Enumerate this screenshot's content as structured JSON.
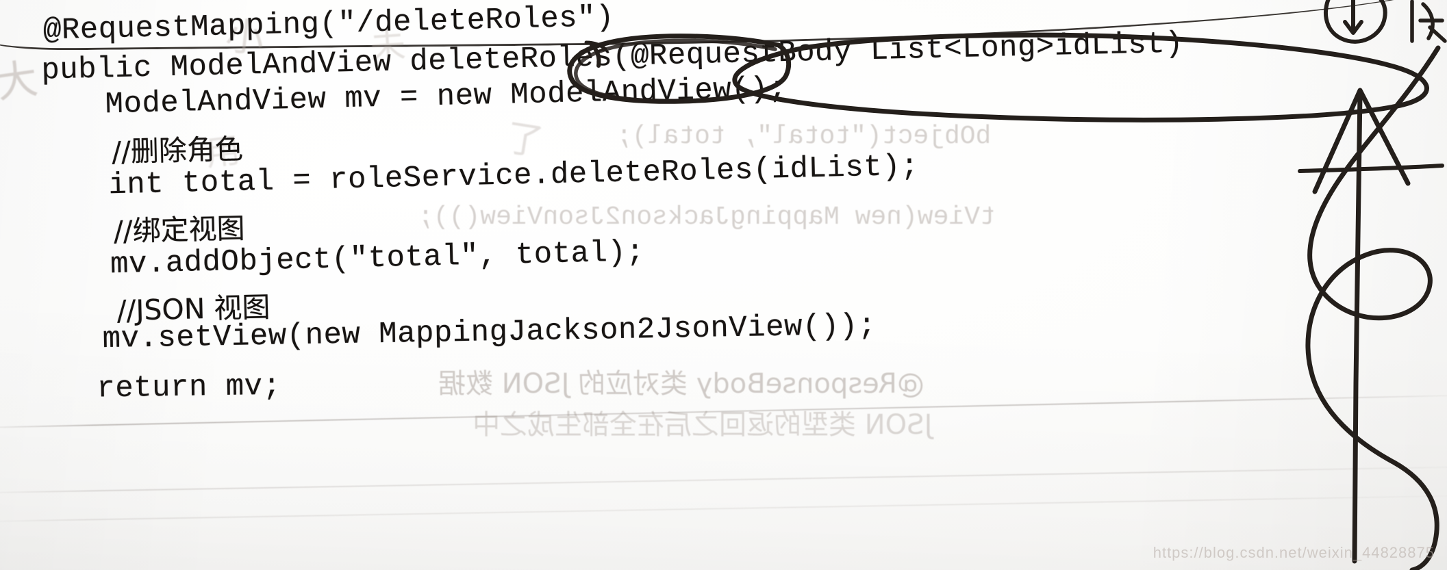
{
  "document": {
    "kind": "scanned-textbook-page",
    "language": "java",
    "watermark": "https://blog.csdn.net/weixin_44828875"
  },
  "code": {
    "lines": [
      {
        "id": "l0",
        "text": "@RequestMapping(\"/deleteRoles\")",
        "kind": "code"
      },
      {
        "id": "l1",
        "text": "public ModelAndView deleteRoles(@RequestBody List<Long>idList)",
        "kind": "code"
      },
      {
        "id": "l2",
        "text": "ModelAndView mv = new ModelAndView();",
        "kind": "code"
      },
      {
        "id": "l3",
        "text": "//删除角色",
        "kind": "comment"
      },
      {
        "id": "l4",
        "text": "int total = roleService.deleteRoles(idList);",
        "kind": "code"
      },
      {
        "id": "l5",
        "text": "//绑定视图",
        "kind": "comment"
      },
      {
        "id": "l6",
        "text": "mv.addObject(\"total\", total);",
        "kind": "code"
      },
      {
        "id": "l7",
        "text": "//JSON 视图",
        "kind": "comment"
      },
      {
        "id": "l8",
        "text": "mv.setView(new MappingJackson2JsonView());",
        "kind": "code"
      },
      {
        "id": "l9",
        "text": "return mv;",
        "kind": "code"
      }
    ]
  },
  "annotations": {
    "circle_inner_label": "@RequestBody",
    "circle_outer_label": "@RequestBody List<Long>idList",
    "marks": [
      {
        "name": "ellipse-around-requestbody",
        "type": "ellipse"
      },
      {
        "name": "ellipse-around-parameter-list",
        "type": "ellipse"
      },
      {
        "name": "up-arrow-pointing-to-parameter",
        "type": "arrow"
      },
      {
        "name": "vertical-squiggle-scribble",
        "type": "squiggle"
      },
      {
        "name": "top-right-handwriting-mark",
        "type": "scribble"
      }
    ]
  },
  "bleed_through": {
    "lines": [
      "bObject(\"total\", total);",
      "tView(new MappingJackson2JsonView());",
      "@ResponseBody 类对应的 JSON 数据",
      "JSON 类型的返回之后在全部生成之中"
    ]
  },
  "ghost_marks": [
    "大",
    "小",
    "未",
    "了",
    "用"
  ],
  "colors": {
    "paper": "#fdfdfc",
    "ink_print": "#171412",
    "ink_pen": "#2a2622",
    "bleed": "#9a8f88",
    "watermark": "#b6aca6"
  }
}
